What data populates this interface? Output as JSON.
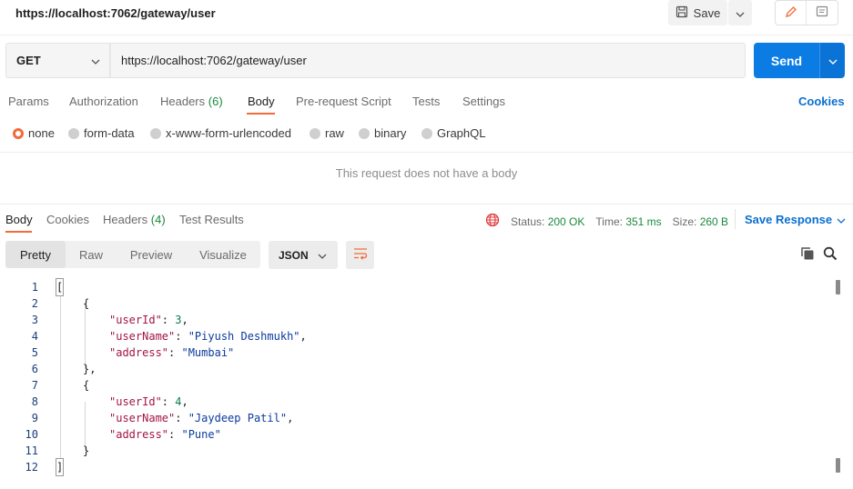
{
  "tab_title": "https://localhost:7062/gateway/user",
  "save_label": "Save",
  "request": {
    "method": "GET",
    "url": "https://localhost:7062/gateway/user",
    "send_label": "Send"
  },
  "request_tabs": [
    {
      "label": "Params"
    },
    {
      "label": "Authorization"
    },
    {
      "label": "Headers",
      "count": "(6)"
    },
    {
      "label": "Body"
    },
    {
      "label": "Pre-request Script"
    },
    {
      "label": "Tests"
    },
    {
      "label": "Settings"
    }
  ],
  "active_request_tab": "Body",
  "cookies_label": "Cookies",
  "body_types": [
    "none",
    "form-data",
    "x-www-form-urlencoded",
    "raw",
    "binary",
    "GraphQL"
  ],
  "selected_body_type": "none",
  "no_body_message": "This request does not have a body",
  "response_tabs": [
    {
      "label": "Body"
    },
    {
      "label": "Cookies"
    },
    {
      "label": "Headers",
      "count": "(4)"
    },
    {
      "label": "Test Results"
    }
  ],
  "status": {
    "status_label": "Status:",
    "status_value": "200 OK",
    "time_label": "Time:",
    "time_value": "351 ms",
    "size_label": "Size:",
    "size_value": "260 B"
  },
  "save_response_label": "Save Response",
  "view_modes": [
    "Pretty",
    "Raw",
    "Preview",
    "Visualize"
  ],
  "active_view_mode": "Pretty",
  "format": "JSON",
  "code_lines": [
    {
      "n": "1",
      "text": "["
    },
    {
      "n": "2",
      "text": "{"
    },
    {
      "n": "3",
      "key": "\"userId\"",
      "num": "3"
    },
    {
      "n": "4",
      "key": "\"userName\"",
      "str": "\"Piyush Deshmukh\""
    },
    {
      "n": "5",
      "key": "\"address\"",
      "str": "\"Mumbai\""
    },
    {
      "n": "6",
      "text": "},"
    },
    {
      "n": "7",
      "text": "{"
    },
    {
      "n": "8",
      "key": "\"userId\"",
      "num": "4"
    },
    {
      "n": "9",
      "key": "\"userName\"",
      "str": "\"Jaydeep Patil\""
    },
    {
      "n": "10",
      "key": "\"address\"",
      "str": "\"Pune\""
    },
    {
      "n": "11",
      "text": "}"
    },
    {
      "n": "12",
      "text": "]"
    }
  ],
  "colors": {
    "accent": "#f26b3a",
    "primary": "#0c7ce5",
    "success": "#198a3c"
  }
}
